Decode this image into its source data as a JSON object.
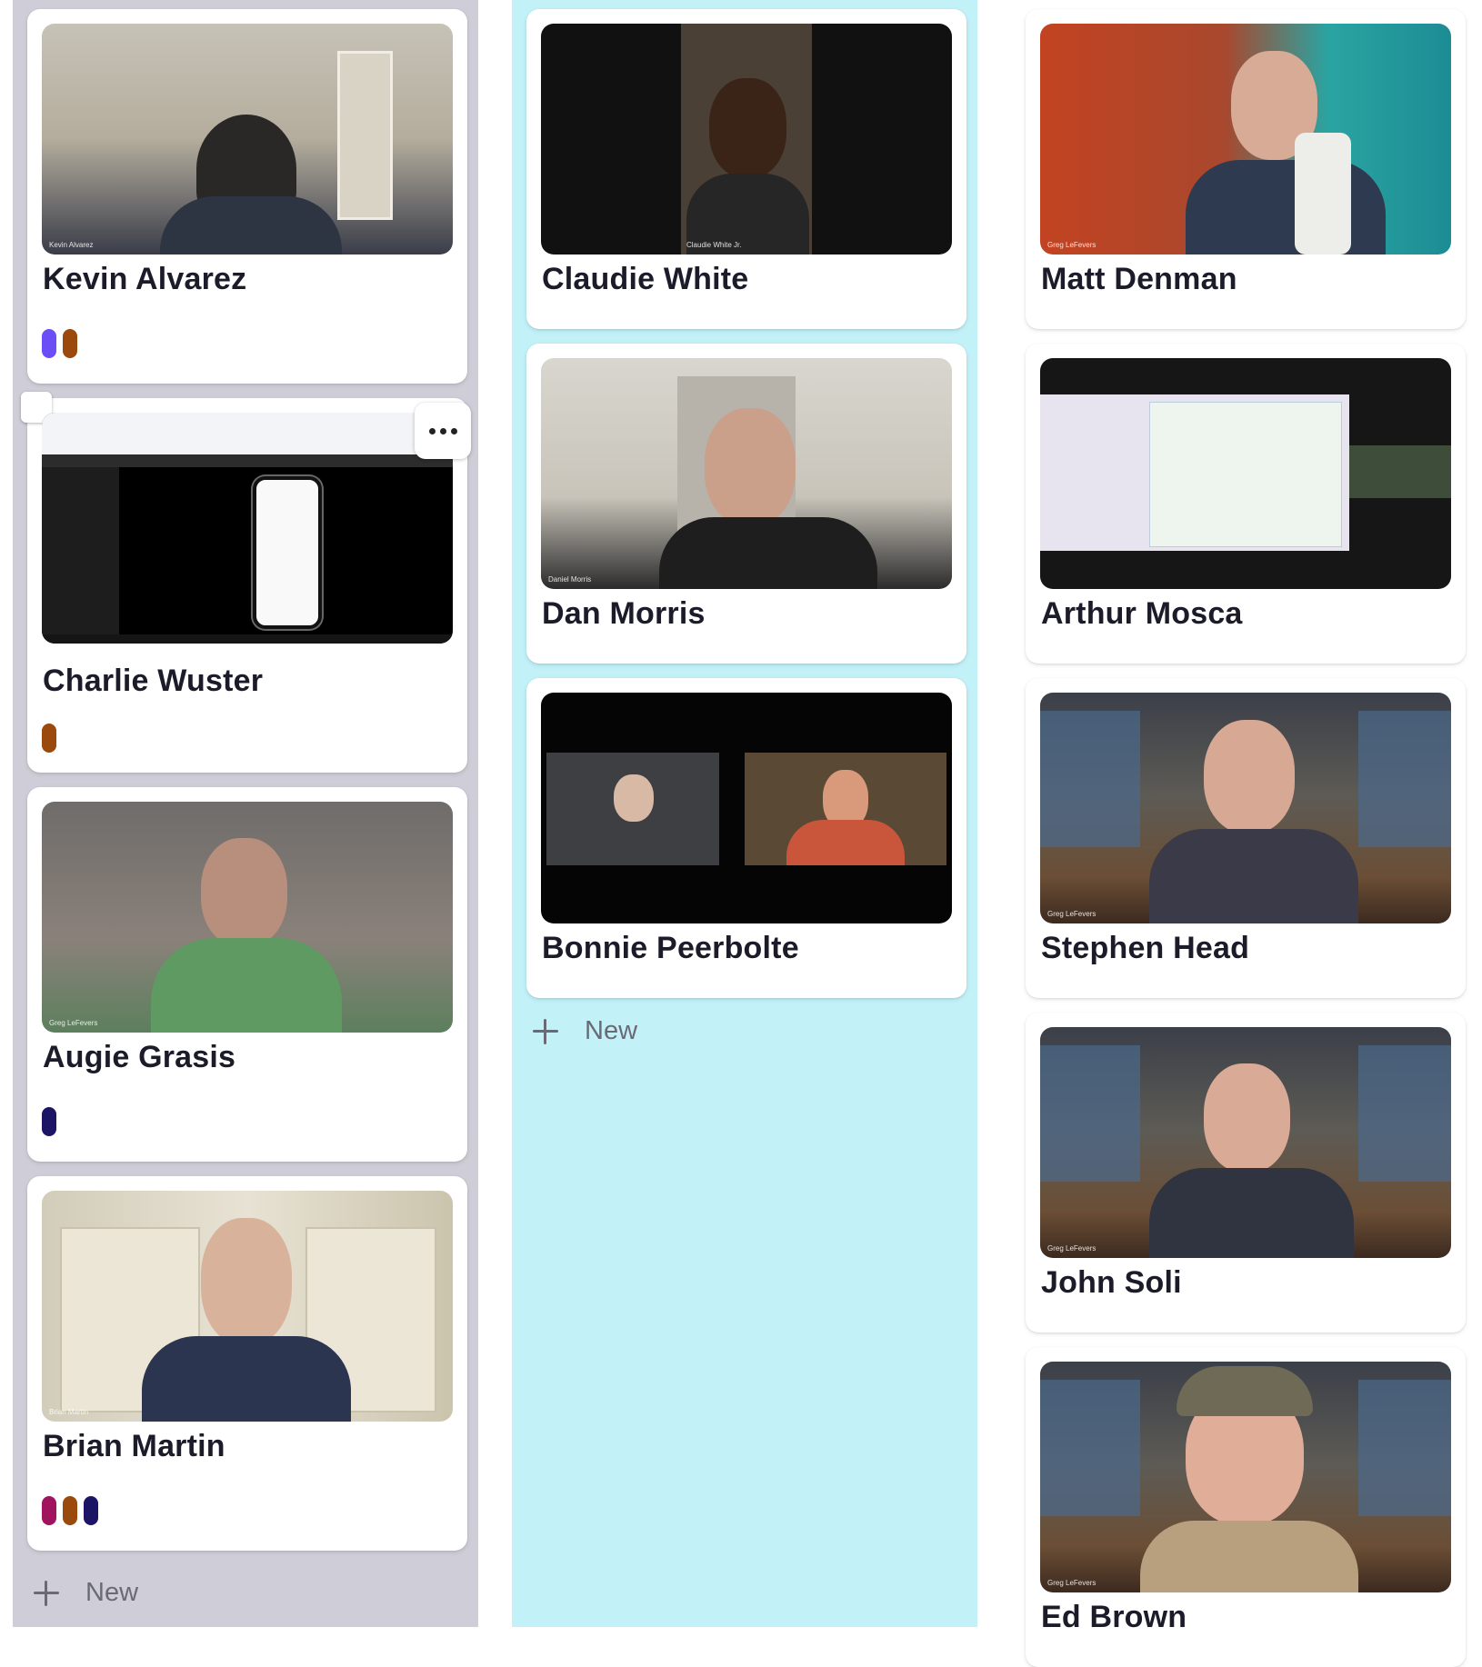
{
  "colors": {
    "col0_bg": "#cfcdd7",
    "col1_bg": "#c2f1f8",
    "col2_bg": "#ffffff",
    "tag_purple": "#6b4ef6",
    "tag_brown": "#9a4a0c",
    "tag_navy": "#1c1464",
    "tag_magenta": "#a0145e"
  },
  "columns": [
    {
      "cards": [
        {
          "name": "Kevin Alvarez",
          "caption": "Kevin Alvarez",
          "tags": [
            "purple",
            "brown"
          ]
        },
        {
          "name": "Charlie Wuster",
          "caption": "",
          "tags": [
            "brown"
          ]
        },
        {
          "name": "Augie Grasis",
          "caption": "Greg LeFevers",
          "tags": [
            "navy"
          ]
        },
        {
          "name": "Brian Martin",
          "caption": "Brian Martin",
          "tags": [
            "magenta",
            "brown",
            "navy"
          ]
        }
      ],
      "new_label": "New"
    },
    {
      "cards": [
        {
          "name": "Claudie White",
          "caption": "Claudie White Jr."
        },
        {
          "name": "Dan Morris",
          "caption": "Daniel Morris"
        },
        {
          "name": "Bonnie Peerbolte",
          "caption": ""
        }
      ],
      "new_label": "New"
    },
    {
      "cards": [
        {
          "name": "Matt Denman",
          "caption": "Greg LeFevers"
        },
        {
          "name": "Arthur Mosca",
          "caption": ""
        },
        {
          "name": "Stephen Head",
          "caption": "Greg LeFevers"
        },
        {
          "name": "John Soli",
          "caption": "Greg LeFevers"
        },
        {
          "name": "Ed Brown",
          "caption": "Greg LeFevers"
        }
      ]
    }
  ]
}
